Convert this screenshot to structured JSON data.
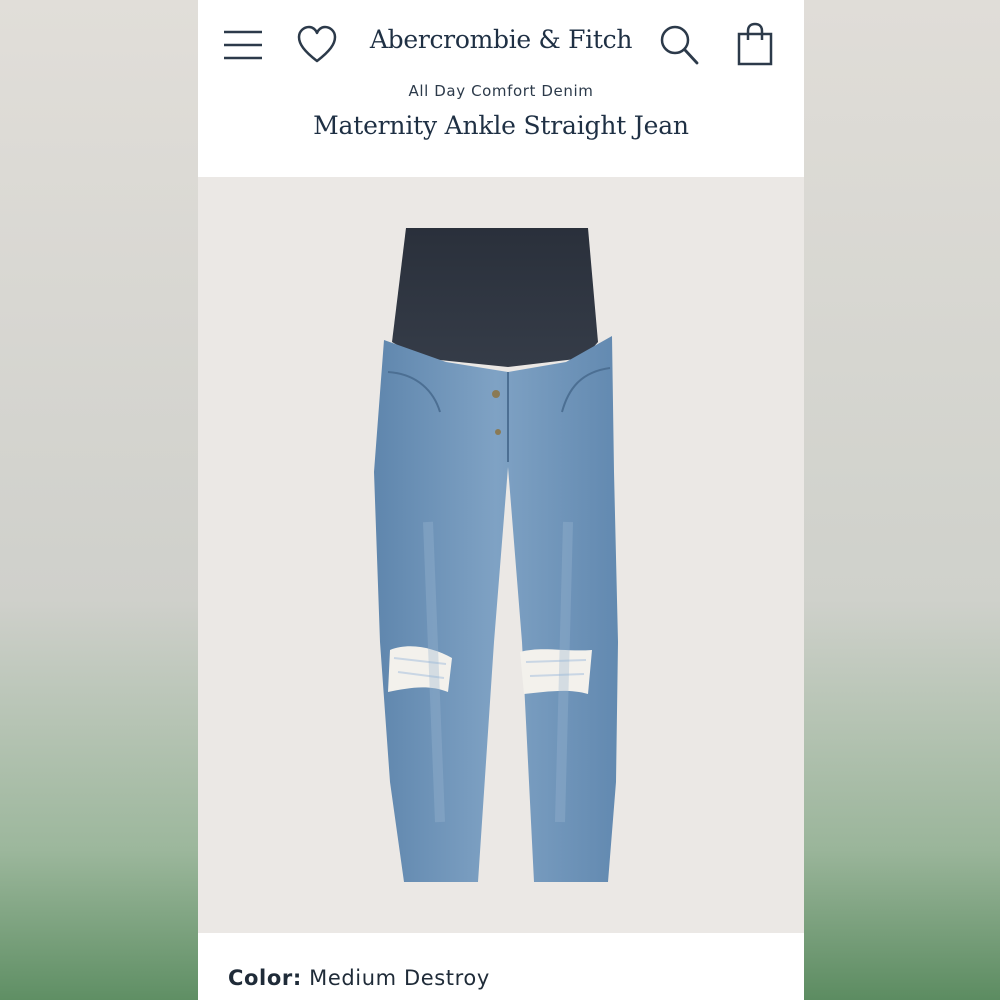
{
  "header": {
    "brand": "Abercrombie & Fitch",
    "icons": {
      "menu": "hamburger-menu-icon",
      "wishlist": "heart-icon",
      "search": "search-icon",
      "bag": "shopping-bag-icon"
    }
  },
  "product": {
    "collection": "All Day Comfort Denim",
    "title": "Maternity Ankle Straight Jean",
    "image_description_icon": "jeans-image",
    "color_label": "Color:",
    "color_value": "Medium Destroy"
  },
  "colors": {
    "brand_navy": "#1f3044",
    "image_bg": "#ebe8e5",
    "denim": "#6f93b8",
    "waistband": "#2d3440"
  }
}
